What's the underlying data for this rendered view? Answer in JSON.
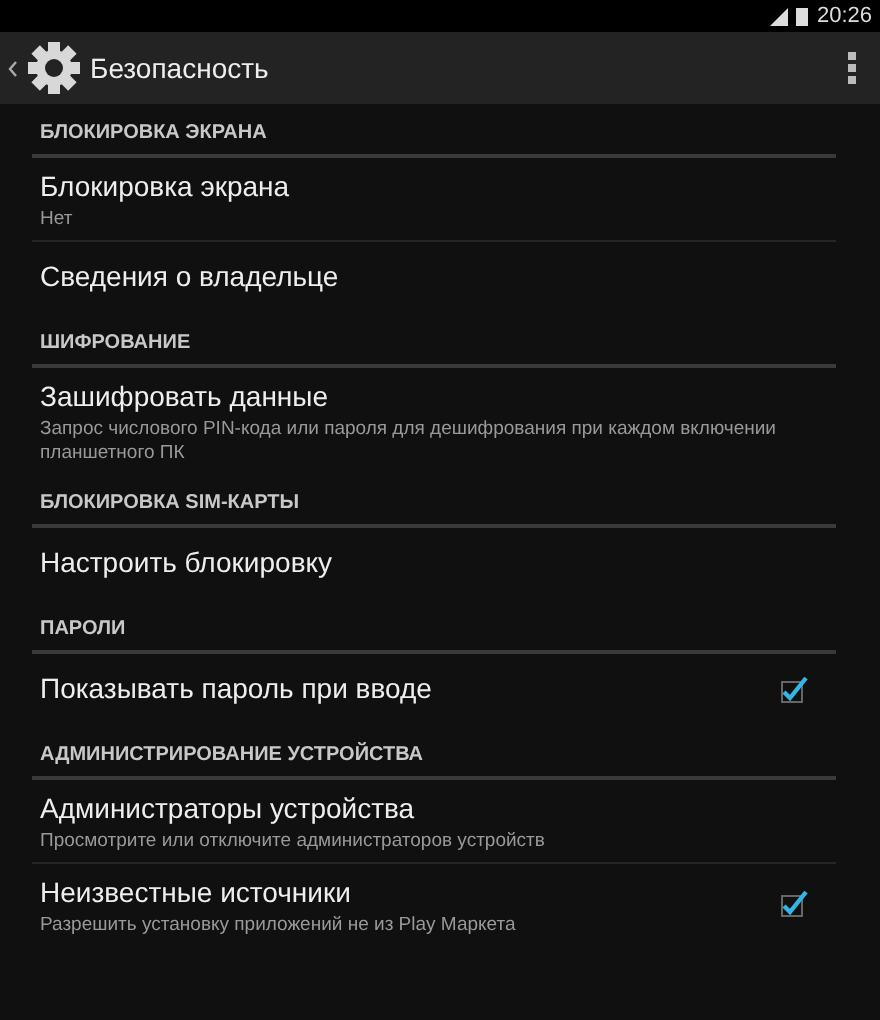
{
  "status_bar": {
    "time": "20:26"
  },
  "action_bar": {
    "title": "Безопасность"
  },
  "items": [
    {
      "kind": "header",
      "title": "БЛОКИРОВКА ЭКРАНА"
    },
    {
      "kind": "item",
      "title": "Блокировка экрана",
      "summary": "Нет"
    },
    {
      "kind": "item",
      "title": "Сведения о владельце"
    },
    {
      "kind": "header",
      "title": "ШИФРОВАНИЕ"
    },
    {
      "kind": "item",
      "title": "Зашифровать данные",
      "summary": "Запрос числового PIN-кода или пароля для дешифрования при каждом включении планшетного ПК"
    },
    {
      "kind": "header",
      "title": "БЛОКИРОВКА SIM-КАРТЫ"
    },
    {
      "kind": "item",
      "title": "Настроить блокировку"
    },
    {
      "kind": "header",
      "title": "ПАРОЛИ"
    },
    {
      "kind": "check",
      "title": "Показывать пароль при вводе",
      "checked": true
    },
    {
      "kind": "header",
      "title": "АДМИНИСТРИРОВАНИЕ УСТРОЙСТВА"
    },
    {
      "kind": "item",
      "title": "Администраторы устройства",
      "summary": "Просмотрите или отключите администраторов устройств"
    },
    {
      "kind": "check",
      "title": "Неизвестные источники",
      "summary": "Разрешить установку приложений не из Play Маркета",
      "checked": true
    }
  ]
}
